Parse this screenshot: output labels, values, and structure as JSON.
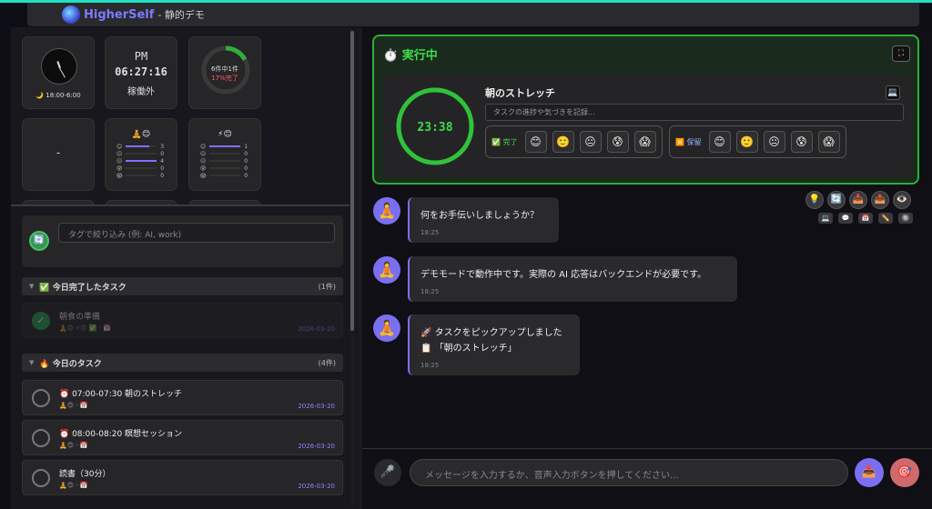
{
  "header": {
    "brand": "HigherSelf",
    "subtitle": "- 静的デモ"
  },
  "widgets": {
    "clock_label": "🌙 18:00-6:00",
    "time_ampm": "PM",
    "time_value": "06:27:16",
    "status": "稼働外",
    "progress_text": "6件中1件",
    "progress_pct_text": "17%完了",
    "progress_fraction": 0.17,
    "dash": "-",
    "mood1": {
      "label": "🧘😊",
      "rows": [
        {
          "icon": "😊",
          "count": "3",
          "level": 0.75
        },
        {
          "icon": "😐",
          "count": "0",
          "level": 0
        },
        {
          "icon": "😐",
          "count": "4",
          "level": 1
        },
        {
          "icon": "😰",
          "count": "0",
          "level": 0
        },
        {
          "icon": "😱",
          "count": "0",
          "level": 0
        }
      ]
    },
    "mood2": {
      "label": "⚡😊",
      "rows": [
        {
          "icon": "😊",
          "count": "1",
          "level": 1
        },
        {
          "icon": "😐",
          "count": "0",
          "level": 0
        },
        {
          "icon": "😐",
          "count": "0",
          "level": 0
        },
        {
          "icon": "😰",
          "count": "0",
          "level": 0
        },
        {
          "icon": "😱",
          "count": "0",
          "level": 0
        }
      ]
    }
  },
  "filter": {
    "icon": "🔄",
    "placeholder": "タグで絞り込み (例: AI, work)"
  },
  "sections": {
    "done": {
      "title": "✅ 今日完了したタスク",
      "count": "(1件)"
    },
    "today": {
      "title": "🔥 今日のタスク",
      "count": "(4件)"
    }
  },
  "done_tasks": [
    {
      "title": "朝食の準備",
      "meta": "🧘😊 ⚡😊 ✅ · 📅",
      "date": "2026-03-20"
    }
  ],
  "tasks": [
    {
      "title": "⏰ 07:00-07:30 朝のストレッチ",
      "meta": "🧘😊 · 📅",
      "date": "2026-03-20"
    },
    {
      "title": "⏰ 08:00-08:20 瞑想セッション",
      "meta": "🧘😊 · 📅",
      "date": "2026-03-20"
    },
    {
      "title": "読書（30分）",
      "meta": "🧘😊 · 📅",
      "date": "2026-03-20"
    }
  ],
  "running": {
    "title": "実行中",
    "icon": "⏱️",
    "task_name": "朝のストレッチ",
    "timer": "23:38",
    "note_placeholder": "タスクの進捗や気づきを記録...",
    "done_label": "✅ 完了",
    "hold_label": "⏸️ 保留",
    "emojis": [
      "😊",
      "🙂",
      "😐",
      "😰",
      "😱"
    ]
  },
  "tools": {
    "row1": [
      "💡",
      "🔄",
      "📥",
      "📤",
      "👁️"
    ],
    "row2": [
      "💻",
      "💬",
      "📅",
      "✏️",
      "🔘"
    ]
  },
  "messages": [
    {
      "avatar": "🧘",
      "lines": [
        "何をお手伝いしましょうか？"
      ],
      "time": "18:25"
    },
    {
      "avatar": "🧘",
      "lines": [
        "デモモードで動作中です。実際の AI 応答はバックエンドが必要です。"
      ],
      "time": "18:25"
    },
    {
      "avatar": "🧘",
      "lines": [
        "🚀 タスクをピックアップしました",
        "📋 「朝のストレッチ」"
      ],
      "time": "18:25"
    }
  ],
  "chat": {
    "placeholder": "メッセージを入力するか、音声入力ボタンを押してください...",
    "mic_icon": "🎤",
    "send_icon": "📥",
    "target_icon": "🎯"
  },
  "colors": {
    "accent": "#7a6ff0",
    "running": "#2fae3a",
    "teal": "#1fe0c0",
    "date": "#9a7cff"
  }
}
